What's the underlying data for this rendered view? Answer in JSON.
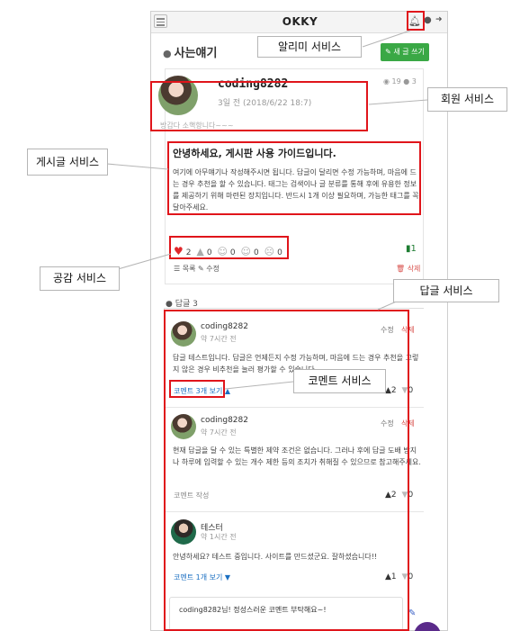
{
  "app": {
    "brand": "OKKY"
  },
  "topbar": {
    "menu_icon": "hamburger-icon",
    "bell_icon": "bell-icon",
    "user_icon": "user-icon",
    "logout_icon": "logout-icon"
  },
  "section": {
    "icon": "speech-bubble-icon",
    "title": "사는얘기",
    "write_button": "✎ 새 글 쓰기"
  },
  "post": {
    "author": "coding8282",
    "date": "3일 전 (2018/6/22 18:7)",
    "views": "19",
    "comments": "3",
    "intro": "방갑다 소핵항니다~~~",
    "title": "안녕하세요, 게시판 사용 가이드입니다.",
    "body": "여기에 아무얘기나 작성해주시면 됩니다. 답글이 달리면 수정 가능하며, 마음에 드는 경우 추천을 할 수 있습니다. 태그는 검색이나 글 분류를 통해 후에 유용한 정보를 제공하기 위해 마련된 장치입니다. 반드시 1개 이상 필요하며, 가능한 태그를 꼭 달아주세요.",
    "reactions": {
      "like": "2",
      "poop": "0",
      "smile": "0",
      "meh": "0",
      "sad": "0"
    },
    "bookmark": "1",
    "list_link": "☰ 목록",
    "edit_link": "✎ 수정",
    "delete_link": "🗑 삭제"
  },
  "answers": {
    "label": "답글 3",
    "items": [
      {
        "author": "coding8282",
        "time": "약 7시간 전",
        "edit": "수정",
        "delete": "삭제",
        "body": "답글 테스트입니다. 답글은 언제든지 수정 가능하며, 마음에 드는 경우 추천을 그렇지 않은 경우 비추천을 눌러 평가할 수 있습니다.",
        "comment_link": "코멘트 3개 보기 ▲",
        "up": "2",
        "down": "0"
      },
      {
        "author": "coding8282",
        "time": "약 7시간 전",
        "edit": "수정",
        "delete": "삭제",
        "body": "현재 답글을 달 수 있는 특별한 제약 조건은 없습니다. 그러나 후에 답글 도배 방지나 하루에 입력할 수 있는 개수 제한 등의 조치가 취해질 수 있으므로 참고해주세요.",
        "comment_link": "코멘트 작성",
        "up": "2",
        "down": "0"
      },
      {
        "author": "테스터",
        "time": "약 1시간 전",
        "body": "안녕하세요? 테스트 중입니다. 사이트를 만드셨군요. 잘하셨습니다!!",
        "comment_link": "코멘트 1개 보기 ▼",
        "up": "1",
        "down": "0"
      }
    ],
    "reply_value": "coding8282님! 정성스러운 코멘트 부탁해요~!"
  },
  "callouts": {
    "notification": "알리미 서비스",
    "member": "회원 서비스",
    "post": "게시글 서비스",
    "empathy": "공감 서비스",
    "answer": "답글 서비스",
    "comment": "코멘트 서비스"
  },
  "colors": {
    "highlight": "#e0151b",
    "accent": "#3aa845",
    "link": "#1a6fc2",
    "danger": "#d9534f"
  }
}
